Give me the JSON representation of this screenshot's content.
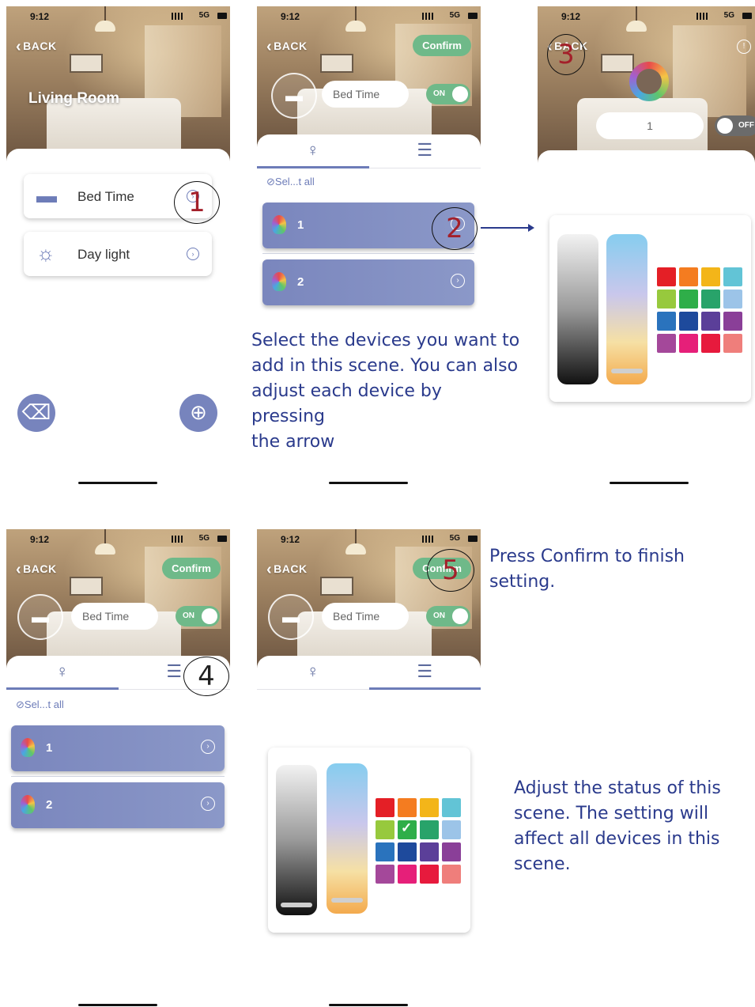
{
  "status": {
    "time": "9:12",
    "network": "5G"
  },
  "nav": {
    "back": "BACK",
    "confirm": "Confirm"
  },
  "screen1": {
    "room_title": "Living Room",
    "scenes": [
      {
        "icon": "bed-icon",
        "label": "Bed Time"
      },
      {
        "icon": "sun-icon",
        "label": "Day light"
      }
    ]
  },
  "scene": {
    "name": "Bed Time",
    "toggle_on": "ON",
    "toggle_off": "OFF"
  },
  "devices": {
    "select_all": "Sel...t all",
    "items": [
      {
        "name": "1",
        "icon": "rgb-bulb-icon"
      },
      {
        "name": "2",
        "icon": "rgb-bulb-icon"
      }
    ]
  },
  "device_settings": {
    "count": "1"
  },
  "palette": {
    "colors": [
      "#e41f26",
      "#f47c20",
      "#f3b519",
      "#62c4d6",
      "#97c93d",
      "#2fae49",
      "#28a36a",
      "#9cc4e8",
      "#2a73bd",
      "#1e4a9c",
      "#5b3f99",
      "#8a3f98",
      "#a4489a",
      "#e61f79",
      "#e71a3d",
      "#ef7e7b"
    ],
    "selected_index": 5
  },
  "annotations": {
    "markers": [
      "1",
      "2",
      "3",
      "4",
      "5"
    ],
    "note_select": [
      "Select the devices you want to",
      "add in this scene. You can also",
      "adjust each device by pressing",
      "the arrow"
    ],
    "note_confirm": [
      "Press Confirm to finish",
      "setting."
    ],
    "note_adjust": [
      "Adjust the status of this",
      "scene. The setting will",
      "affect all devices in this",
      "scene."
    ]
  }
}
